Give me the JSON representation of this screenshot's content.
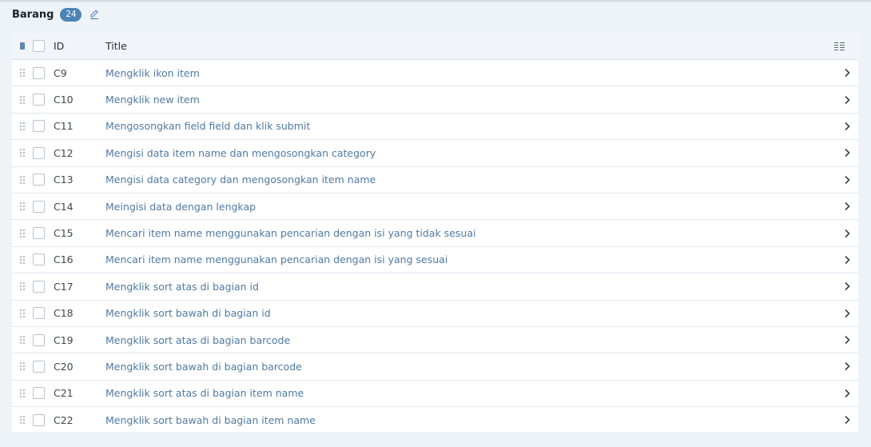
{
  "section": {
    "title": "Barang",
    "count": "24"
  },
  "table": {
    "columns": {
      "id": "ID",
      "title": "Title"
    },
    "rows": [
      {
        "id": "C9",
        "title": "Mengklik ikon item"
      },
      {
        "id": "C10",
        "title": "Mengklik new item"
      },
      {
        "id": "C11",
        "title": "Mengosongkan field field dan klik submit"
      },
      {
        "id": "C12",
        "title": "Mengisi data item name dan mengosongkan category"
      },
      {
        "id": "C13",
        "title": "Mengisi data category dan mengosongkan item name"
      },
      {
        "id": "C14",
        "title": "Meingisi data dengan lengkap"
      },
      {
        "id": "C15",
        "title": "Mencari item name menggunakan pencarian dengan isi yang tidak sesuai"
      },
      {
        "id": "C16",
        "title": "Mencari item name menggunakan pencarian dengan isi yang sesuai"
      },
      {
        "id": "C17",
        "title": "Mengklik sort atas di bagian id"
      },
      {
        "id": "C18",
        "title": "Mengklik sort bawah di bagian id"
      },
      {
        "id": "C19",
        "title": "Mengklik sort atas di bagian barcode"
      },
      {
        "id": "C20",
        "title": "Mengklik sort bawah di bagian barcode"
      },
      {
        "id": "C21",
        "title": "Mengklik sort atas di bagian item name"
      },
      {
        "id": "C22",
        "title": "Mengklik sort bawah di bagian item name"
      }
    ]
  },
  "icons": {
    "edit": "pencil-icon",
    "bulk": "bulk-select-icon",
    "drag": "drag-handle-icon",
    "row_open": "chevron-right-icon",
    "columns_menu": "column-settings-icon"
  },
  "colors": {
    "badge": "#4d84b6",
    "link": "#4f7aa3",
    "page_bg": "#eef3f8"
  }
}
